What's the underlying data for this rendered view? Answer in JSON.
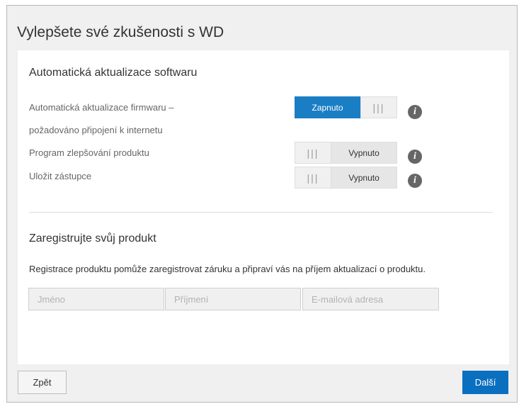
{
  "dialog": {
    "title": "Vylepšete své zkušenosti s WD"
  },
  "software_update": {
    "title": "Automatická aktualizace softwaru",
    "rows": [
      {
        "label_line1": "Automatická aktualizace firmwaru –",
        "label_line2": "požadováno připojení k internetu",
        "state_label": "Zapnuto",
        "state": "on"
      },
      {
        "label": "Program zlepšování produktu",
        "state_label": "Vypnuto",
        "state": "off"
      },
      {
        "label": "Uložit zástupce",
        "state_label": "Vypnuto",
        "state": "off"
      }
    ],
    "toggle_grip_glyph": "|||",
    "info_glyph": "i",
    "info_icon_name": "info-icon"
  },
  "registration": {
    "title": "Zaregistrujte svůj produkt",
    "description": "Registrace produktu pomůže zaregistrovat záruku a připraví vás na příjem aktualizací o produktu.",
    "fields": {
      "first_name_placeholder": "Jméno",
      "last_name_placeholder": "Příjmení",
      "email_placeholder": "E-mailová adresa"
    }
  },
  "footer": {
    "back_label": "Zpět",
    "next_label": "Další"
  },
  "colors": {
    "accent": "#1a7ec4",
    "next_button": "#0b6fbf",
    "dialog_background": "#f0f0f0",
    "info_icon": "#666666"
  }
}
